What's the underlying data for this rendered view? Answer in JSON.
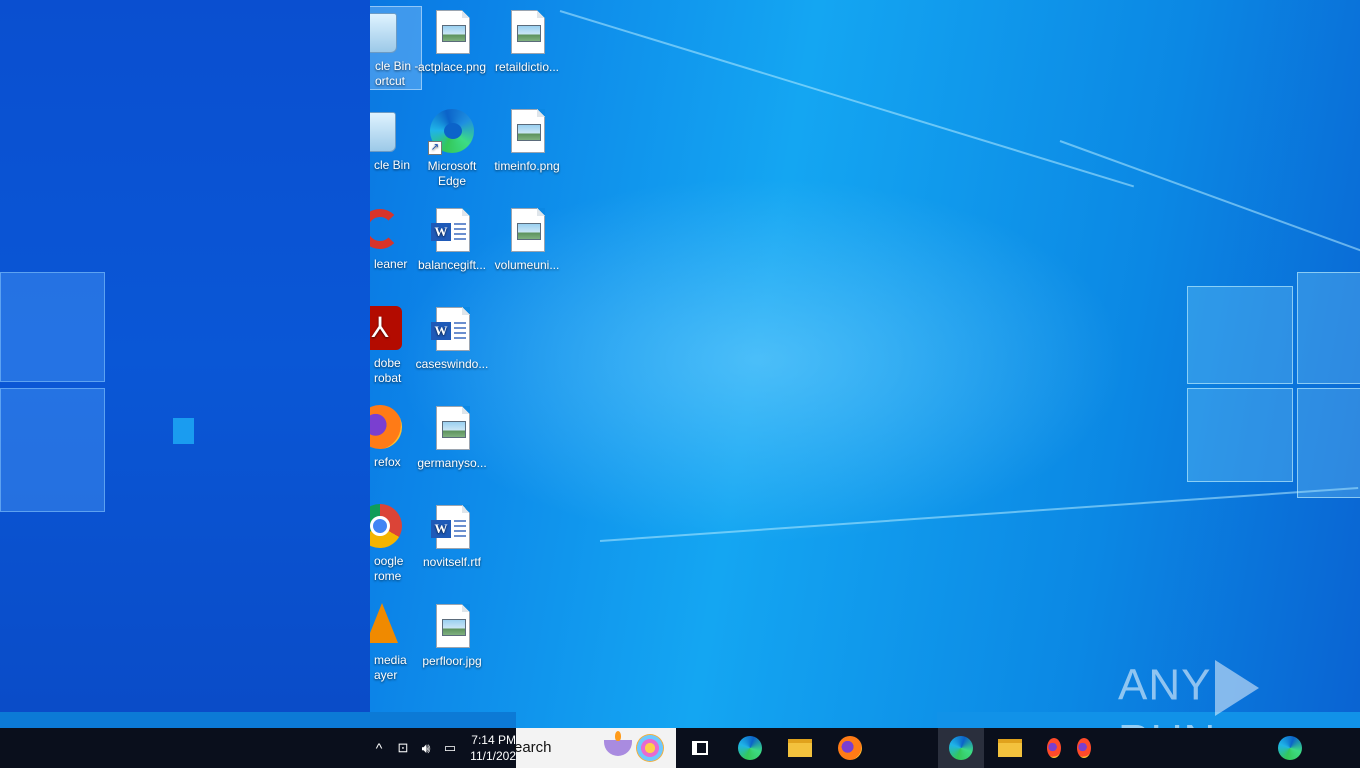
{
  "desktop": {
    "icons_clipped": [
      {
        "label": "cle Bin -\nortcut",
        "icon": "recycle-bin-icon"
      },
      {
        "label": "cle Bin",
        "icon": "recycle-bin-icon"
      },
      {
        "label": "leaner",
        "icon": "ccleaner-icon"
      },
      {
        "label": "dobe\nrobat",
        "icon": "acrobat-icon"
      },
      {
        "label": "refox",
        "icon": "firefox-icon"
      },
      {
        "label": "oogle\nrome",
        "icon": "chrome-icon"
      },
      {
        "label": " media\nayer",
        "icon": "vlc-icon"
      }
    ],
    "icons_col2": [
      {
        "label": "actplace.png",
        "icon": "image-file-icon"
      },
      {
        "label": "Microsoft\nEdge",
        "icon": "edge-icon"
      },
      {
        "label": "balancegift...",
        "icon": "word-file-icon"
      },
      {
        "label": "caseswindo...",
        "icon": "word-file-icon"
      },
      {
        "label": "germanyso...",
        "icon": "image-file-icon"
      },
      {
        "label": "novitself.rtf",
        "icon": "word-file-icon"
      },
      {
        "label": "perfloor.jpg",
        "icon": "image-file-icon"
      }
    ],
    "icons_col3": [
      {
        "label": "retaildictio...",
        "icon": "image-file-icon"
      },
      {
        "label": "timeinfo.png",
        "icon": "image-file-icon"
      },
      {
        "label": "volumeuni...",
        "icon": "image-file-icon"
      }
    ]
  },
  "watermark": {
    "left": "ANY",
    "right": "RUN"
  },
  "taskbar": {
    "time": "7:14 PM",
    "date": "11/1/202",
    "search_placeholder": "earch",
    "tray_chevron": "^"
  },
  "colors": {
    "taskbar_bg": "#0a0f1c",
    "desktop_accent": "#0b7fe6",
    "panel_bg": "#0a4fd0"
  }
}
